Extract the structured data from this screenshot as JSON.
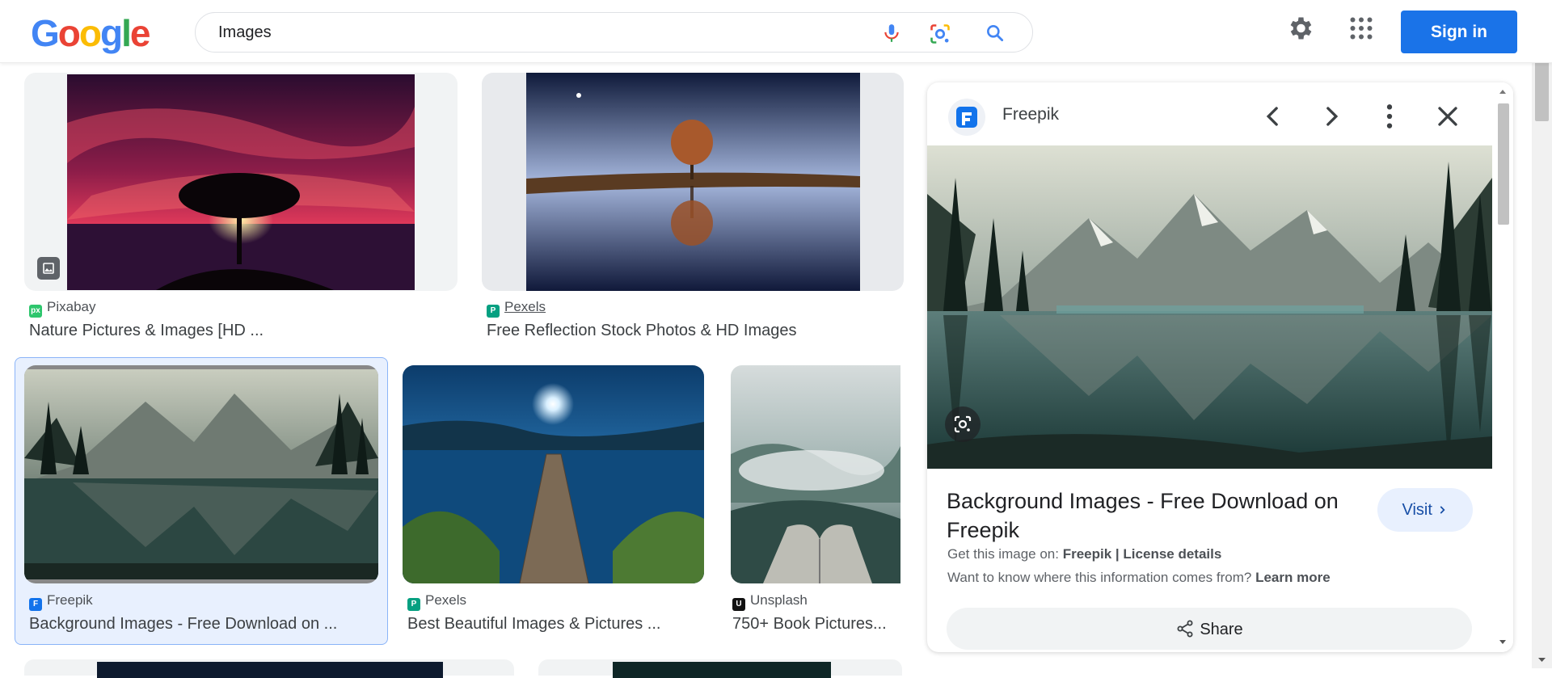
{
  "header": {
    "logo_letters": [
      "G",
      "o",
      "o",
      "g",
      "l",
      "e"
    ],
    "search_value": "Images",
    "signin_label": "Sign in",
    "icons": [
      "mic-icon",
      "lens-icon",
      "search-icon",
      "settings-icon",
      "apps-icon"
    ]
  },
  "results": [
    {
      "source": "Pixabay",
      "title": "Nature Pictures & Images [HD ...",
      "favicon": "px"
    },
    {
      "source": "Pexels",
      "title": "Free Reflection Stock Photos & HD Images",
      "favicon": "P"
    },
    {
      "source": "Freepik",
      "title": "Background Images - Free Download on ...",
      "favicon": "F"
    },
    {
      "source": "Pexels",
      "title": "Best Beautiful Images & Pictures ...",
      "favicon": "P"
    },
    {
      "source": "Unsplash",
      "title": "750+ Book Pictures...",
      "favicon": "U"
    }
  ],
  "panel": {
    "source": "Freepik",
    "title": "Background Images - Free Download on Freepik",
    "visit_label": "Visit",
    "get_image_prefix": "Get this image on:",
    "get_image_source": "Freepik",
    "separator": "|",
    "license_label": "License details",
    "info_text": "Want to know where this information comes from?",
    "learn_more_label": "Learn more",
    "share_label": "Share"
  },
  "colors": {
    "accent": "#1a73e8",
    "selected_bg": "#e8f0fe",
    "pixabay": "#2ec66d",
    "pexels": "#05a081",
    "freepik": "#1273eb"
  }
}
